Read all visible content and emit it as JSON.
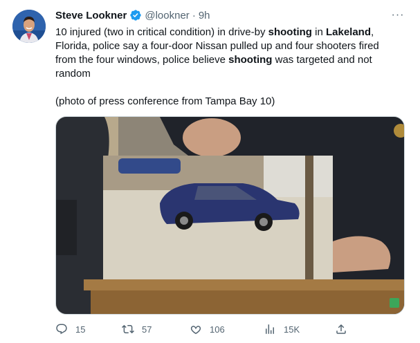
{
  "author": {
    "name": "Steve Lookner",
    "handle": "@lookner",
    "separator": "·",
    "time": "9h",
    "verified_color": "#1d9bf0"
  },
  "tweet": {
    "text_parts": [
      "10 injured (two in critical condition) in drive-by ",
      "shooting",
      " in ",
      "Lakeland",
      ", Florida, police say a four-door Nissan pulled up and four shooters fired from the four windows, police believe ",
      "shooting",
      " was targeted and not random"
    ],
    "photo_credit": "(photo of press conference from Tampa Bay 10)"
  },
  "more_button": {
    "icon": "more-horizontal-icon",
    "label": "···"
  },
  "actions": {
    "reply": {
      "icon": "reply-icon",
      "count": "15"
    },
    "retweet": {
      "icon": "retweet-icon",
      "count": "57"
    },
    "like": {
      "icon": "like-icon",
      "count": "106"
    },
    "views": {
      "icon": "views-icon",
      "count": "15K"
    },
    "share": {
      "icon": "share-icon"
    }
  },
  "colors": {
    "text_primary": "#0f1419",
    "text_secondary": "#536471",
    "accent": "#1d9bf0",
    "border": "#cfd9de"
  }
}
